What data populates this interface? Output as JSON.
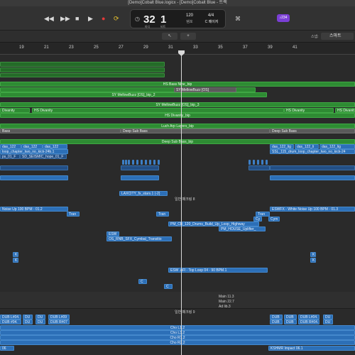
{
  "window": {
    "title": "[Demo]Cobalt Blue.logicx - [Demo]Cobalt Blue - 트랙"
  },
  "transport": {
    "rewind_icon": "rewind-icon",
    "forward_icon": "fast-forward-icon",
    "stop_icon": "stop-icon",
    "play_icon": "play-icon",
    "record_icon": "record-icon",
    "cycle_icon": "cycle-icon",
    "lcd_icon": "display-mode-icon",
    "bar": "32",
    "beat": "1",
    "bar_label": "마디",
    "beat_label": "비트",
    "tempo": "120",
    "tempo_label": "템포",
    "signature": "4/4",
    "key": "C 메이저",
    "mode_label": "⌘",
    "badge_label": "♪234"
  },
  "toolbar": {
    "pointer_tool": "↖",
    "pencil_tool": "+",
    "snap_label": "스냅:",
    "snap_value": "스마트"
  },
  "ruler": {
    "numbers": [
      "19",
      "21",
      "23",
      "25",
      "27",
      "29",
      "31",
      "33",
      "35",
      "37",
      "39",
      "41"
    ]
  },
  "regions": {
    "hs_bass_nine": "HS Bass Nine_bip",
    "mellowbuzz_a": "SY MellowBuzz [OS]",
    "mellowbuzz_2": "SY MellowBuzz [OS]_bip_2",
    "mellowbuzz_3": "SY MellowBuzz [OS]_bip_3",
    "divanity_left": "Divanity",
    "hs_divanity": "HS Divanity",
    "hs_divanity_r1": "HS Divanity",
    "hs_divanity_r2": "HS Divanity",
    "hs_divanity_bip": "HS Divanity_bip",
    "luch_arp": "Luch Arp Layers_bip",
    "sub_bass_left": "Bass",
    "deep_sub_bass": "Deep Sub Bass",
    "deep_sub_bass_r": "Deep Sub Bass",
    "deep_sub_bass_bip": "Deep Sub Bass_bip",
    "das_122_a": "das_122",
    "das_122_b": "das_122",
    "das_122_c": "das_122",
    "das_122_r1": "das_122_lig",
    "das_122_r2": "das_122_li",
    "das_122_r3": "das_122_lig",
    "drum_loop_left": "loop_chapter_two_no_kick-24b.1",
    "drum_loop_right": "SSL_115_drum_loop_chapter_two_no_kick-24",
    "seismic_a": "ps_01_F",
    "seismic_b": "SD_SEISMIC_hope_01_F",
    "laxcity": "LAXCITY_fx_stars.1 (-2)",
    "marker_1": "일반 패크링 8",
    "noise_up_left": "Noise Up 100 BPM - 01.2",
    "noise_up_right": "ESWFX - White Noise Up 100 BPM - 01.3",
    "tran_a": "Tran",
    "tran_b": "Tran",
    "tran_c": "Tran",
    "cy": "Cy",
    "cym": "Cym",
    "pm_build_up": "PM_CB_120_Drums_Build_Up_Loop_Highway",
    "pm_house": "PM_HOUSE_Uplifter_",
    "esw": "ESW",
    "cymbal_transition": "OS_RNB_SFX_Cymbal_Transitio",
    "k1": "K",
    "k2": "K",
    "k3": "K",
    "k4": "K",
    "top_loop": "ESW .oFl - Top Loop 04 - 90 BPM.1",
    "c1": "C",
    "c2": "C",
    "main_113": "Main 11.3",
    "main_227": "Main 22.7",
    "ad_lib": "Ad lib.3",
    "marker_2": "일반 패크링 9",
    "dub_1": "DUB L#04.",
    "dub_2": "DU",
    "dub_3": "DU",
    "dub_4": "DUB L#09",
    "dub_5": "DUB #04.",
    "dub_6": "DU",
    "dub_7": "DU",
    "dub_8": "DUB R#07",
    "dub_r1": "DUB",
    "dub_r2": "DUB",
    "dub_r3": "DUB L#04.",
    "dub_r4": "DU",
    "dub_r5": "DUB",
    "dub_r6": "DUB",
    "dub_r7": "DUB R#04.",
    "dub_r8": "DU",
    "cho_l1": "Cho L1.2",
    "cho_l3": "Cho L3.2",
    "cho_r1": "Cho R1.2",
    "cho_r2": "Cho R2.2",
    "bottom_left": "06",
    "kshmr": "KSHMR Impact 06.1"
  }
}
